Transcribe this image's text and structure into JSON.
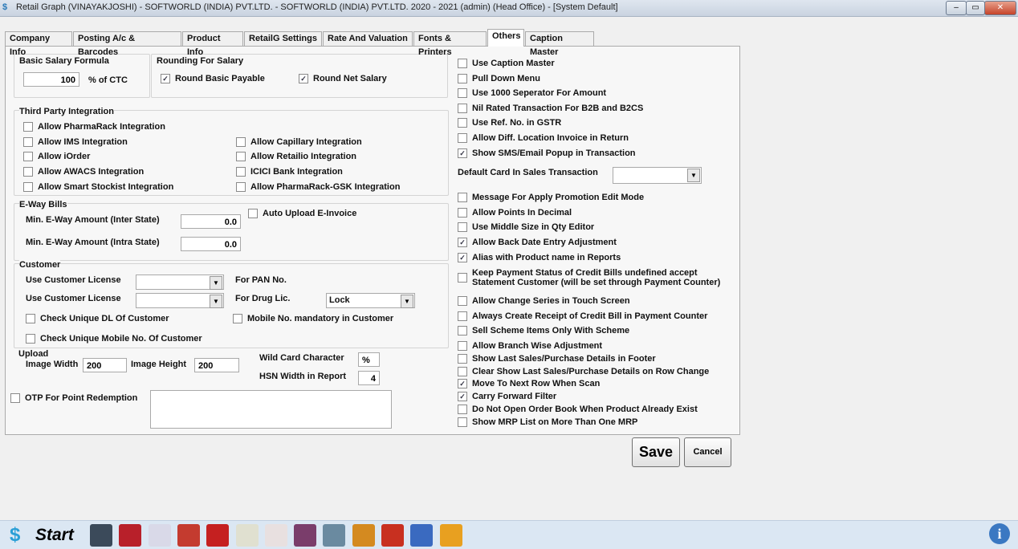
{
  "window": {
    "title": "Retail Graph (VINAYAKJOSHI) - SOFTWORLD (INDIA) PVT.LTD. - SOFTWORLD (INDIA) PVT.LTD.  2020 - 2021 (admin) (Head Office)  - [System Default]",
    "min": "–",
    "max": "▭",
    "close": "✕"
  },
  "tabs": [
    "Company Info",
    "Posting A/c & Barcodes",
    "Product Info",
    "RetailG Settings",
    "Rate And Valuation",
    "Fonts & Printers",
    "Others",
    "Caption Master"
  ],
  "active_tab": "Others",
  "basic_salary": {
    "title": "Basic Salary Formula",
    "value": "100",
    "suffix": "% of CTC"
  },
  "rounding": {
    "title": "Rounding For Salary",
    "items": [
      {
        "label": "Round Basic Payable",
        "checked": true
      },
      {
        "label": "Round Net Salary",
        "checked": true
      }
    ]
  },
  "third_party": {
    "title": "Third Party Integration",
    "left": [
      {
        "label": "Allow PharmaRack Integration",
        "checked": false
      },
      {
        "label": "Allow IMS Integration",
        "checked": false
      },
      {
        "label": "Allow iOrder",
        "checked": false
      },
      {
        "label": "Allow AWACS Integration",
        "checked": false
      },
      {
        "label": "Allow Smart Stockist Integration",
        "checked": false
      }
    ],
    "right": [
      {
        "label": "Allow Capillary Integration",
        "checked": false
      },
      {
        "label": "Allow Retailio Integration",
        "checked": false
      },
      {
        "label": "ICICI Bank Integration",
        "checked": false
      },
      {
        "label": "Allow PharmaRack-GSK Integration",
        "checked": false
      }
    ]
  },
  "eway": {
    "title": "E-Way Bills",
    "inter_label": "Min. E-Way Amount (Inter State)",
    "inter_value": "0.0",
    "intra_label": "Min. E-Way Amount (Intra State)",
    "intra_value": "0.0",
    "auto_upload": "Auto Upload E-Invoice"
  },
  "customer": {
    "title": "Customer",
    "license1": "Use Customer License",
    "license2": "Use Customer License",
    "pan": "For PAN No.",
    "drug": "For Drug Lic.",
    "drug_value": "Lock",
    "unique_dl": "Check Unique DL Of Customer",
    "mobile_mandatory": "Mobile No. mandatory in Customer",
    "unique_mobile": "Check Unique Mobile No. Of Customer"
  },
  "upload": {
    "title": "Upload",
    "width_label": "Image Width",
    "width": "200",
    "height_label": "Image Height",
    "height": "200",
    "wildcard_label": "Wild Card Character",
    "wildcard": "%",
    "hsn_label": "HSN Width in Report",
    "hsn": "4"
  },
  "otp": "OTP For Point Redemption",
  "right_options_1": [
    {
      "label": "Use Caption Master",
      "checked": false
    },
    {
      "label": "Pull Down Menu",
      "checked": false
    },
    {
      "label": "Use 1000 Seperator For Amount",
      "checked": false
    },
    {
      "label": "Nil Rated Transaction For B2B and B2CS",
      "checked": false
    },
    {
      "label": "Use Ref. No. in GSTR",
      "checked": false
    },
    {
      "label": "Allow Diff. Location Invoice in Return",
      "checked": false
    },
    {
      "label": "Show SMS/Email Popup in Transaction",
      "checked": true
    }
  ],
  "default_card_label": "Default Card In Sales Transaction",
  "right_options_2": [
    {
      "label": "Message For Apply Promotion Edit Mode",
      "checked": false
    },
    {
      "label": "Allow Points In Decimal",
      "checked": false
    },
    {
      "label": "Use Middle Size in Qty Editor",
      "checked": false
    },
    {
      "label": "Allow Back Date Entry Adjustment",
      "checked": true
    },
    {
      "label": "Alias with Product name in Reports",
      "checked": true
    }
  ],
  "keep_payment": {
    "line1": "Keep Payment Status of Credit Bills undefined accept",
    "line2": " Statement Customer (will be set through Payment Counter)",
    "checked": false
  },
  "right_options_3": [
    {
      "label": "Allow Change Series in Touch Screen",
      "checked": false
    },
    {
      "label": "Always Create Receipt of Credit Bill in Payment Counter",
      "checked": false
    },
    {
      "label": "Sell Scheme Items Only With Scheme",
      "checked": false
    },
    {
      "label": "Allow Branch Wise Adjustment",
      "checked": false
    },
    {
      "label": "Show Last Sales/Purchase Details in Footer",
      "checked": false
    },
    {
      "label": "Clear Show Last Sales/Purchase Details on Row Change",
      "checked": false
    },
    {
      "label": "Move To Next Row When Scan",
      "checked": true
    },
    {
      "label": "Carry Forward Filter",
      "checked": true
    },
    {
      "label": "Do Not Open Order Book When Product Already Exist",
      "checked": false
    },
    {
      "label": "Show MRP List on More Than One MRP",
      "checked": false
    }
  ],
  "buttons": {
    "save": "Save",
    "cancel": "Cancel"
  },
  "taskbar": {
    "start": "Start",
    "icons": [
      "sale-book",
      "purchase-book",
      "product",
      "day-book",
      "p-report",
      "re-clipboard",
      "pe-clipboard",
      "cash",
      "transfer",
      "money-bag",
      "shapes",
      "printer",
      "settings"
    ],
    "info": "i"
  }
}
